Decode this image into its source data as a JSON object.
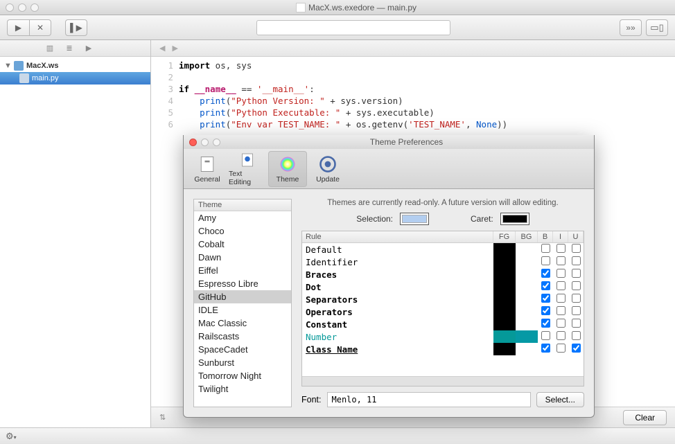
{
  "window_title": "MacX.ws.exedore — main.py",
  "toolbar": {
    "clear_label": "Clear"
  },
  "sidebar": {
    "project_name": "MacX.ws",
    "file_name": "main.py"
  },
  "code": {
    "line_numbers": [
      "1",
      "2",
      "3",
      "4",
      "5",
      "6"
    ],
    "tokens": [
      [
        {
          "t": "import",
          "c": "kw"
        },
        {
          "t": " os, sys"
        }
      ],
      [],
      [
        {
          "t": "if",
          "c": "kw"
        },
        {
          "t": " "
        },
        {
          "t": "__name__",
          "c": "mag"
        },
        {
          "t": " == "
        },
        {
          "t": "'__main__'",
          "c": "str"
        },
        {
          "t": ":"
        }
      ],
      [
        {
          "t": "    "
        },
        {
          "t": "print",
          "c": "blue"
        },
        {
          "t": "("
        },
        {
          "t": "\"Python Version: \"",
          "c": "str"
        },
        {
          "t": " + sys.version)"
        }
      ],
      [
        {
          "t": "    "
        },
        {
          "t": "print",
          "c": "blue"
        },
        {
          "t": "("
        },
        {
          "t": "\"Python Executable: \"",
          "c": "str"
        },
        {
          "t": " + sys.executable)"
        }
      ],
      [
        {
          "t": "    "
        },
        {
          "t": "print",
          "c": "blue"
        },
        {
          "t": "("
        },
        {
          "t": "\"Env var TEST_NAME: \"",
          "c": "str"
        },
        {
          "t": " + os.getenv("
        },
        {
          "t": "'TEST_NAME'",
          "c": "str"
        },
        {
          "t": ", "
        },
        {
          "t": "None",
          "c": "blue"
        },
        {
          "t": "))"
        }
      ]
    ]
  },
  "prefs": {
    "title": "Theme Preferences",
    "tabs": [
      {
        "label": "General",
        "sel": false
      },
      {
        "label": "Text Editing",
        "sel": false
      },
      {
        "label": "Theme",
        "sel": true
      },
      {
        "label": "Update",
        "sel": false
      }
    ],
    "theme_header": "Theme",
    "themes": [
      "Amy",
      "Choco",
      "Cobalt",
      "Dawn",
      "Eiffel",
      "Espresso Libre",
      "GitHub",
      "IDLE",
      "Mac Classic",
      "Railscasts",
      "SpaceCadet",
      "Sunburst",
      "Tomorrow Night",
      "Twilight"
    ],
    "selected_theme": "GitHub",
    "info_text": "Themes are currently read-only. A future version will allow editing.",
    "selection_label": "Selection:",
    "caret_label": "Caret:",
    "rule_headers": {
      "rule": "Rule",
      "fg": "FG",
      "bg": "BG",
      "b": "B",
      "i": "I",
      "u": "U"
    },
    "rules": [
      {
        "name": "Default",
        "fg": "#000000",
        "bg": "#ffffff",
        "b": false,
        "i": false,
        "u": false,
        "bold": false,
        "color": ""
      },
      {
        "name": "Identifier",
        "fg": "#000000",
        "bg": "",
        "b": false,
        "i": false,
        "u": false,
        "bold": false,
        "color": ""
      },
      {
        "name": "Braces",
        "fg": "#000000",
        "bg": "",
        "b": true,
        "i": false,
        "u": false,
        "bold": true,
        "color": ""
      },
      {
        "name": "Dot",
        "fg": "#000000",
        "bg": "",
        "b": true,
        "i": false,
        "u": false,
        "bold": true,
        "color": ""
      },
      {
        "name": "Separators",
        "fg": "#000000",
        "bg": "",
        "b": true,
        "i": false,
        "u": false,
        "bold": true,
        "color": ""
      },
      {
        "name": "Operators",
        "fg": "#000000",
        "bg": "",
        "b": true,
        "i": false,
        "u": false,
        "bold": true,
        "color": ""
      },
      {
        "name": "Constant",
        "fg": "#000000",
        "bg": "",
        "b": true,
        "i": false,
        "u": false,
        "bold": true,
        "color": ""
      },
      {
        "name": "Number",
        "fg": "#059999",
        "bg": "#0599a5",
        "b": false,
        "i": false,
        "u": false,
        "bold": false,
        "color": "#059999"
      },
      {
        "name": "Class Name",
        "fg": "#000000",
        "bg": "",
        "b": true,
        "i": false,
        "u": true,
        "bold": true,
        "color": ""
      }
    ],
    "font_label": "Font:",
    "font_value": "Menlo, 11",
    "select_label": "Select..."
  }
}
